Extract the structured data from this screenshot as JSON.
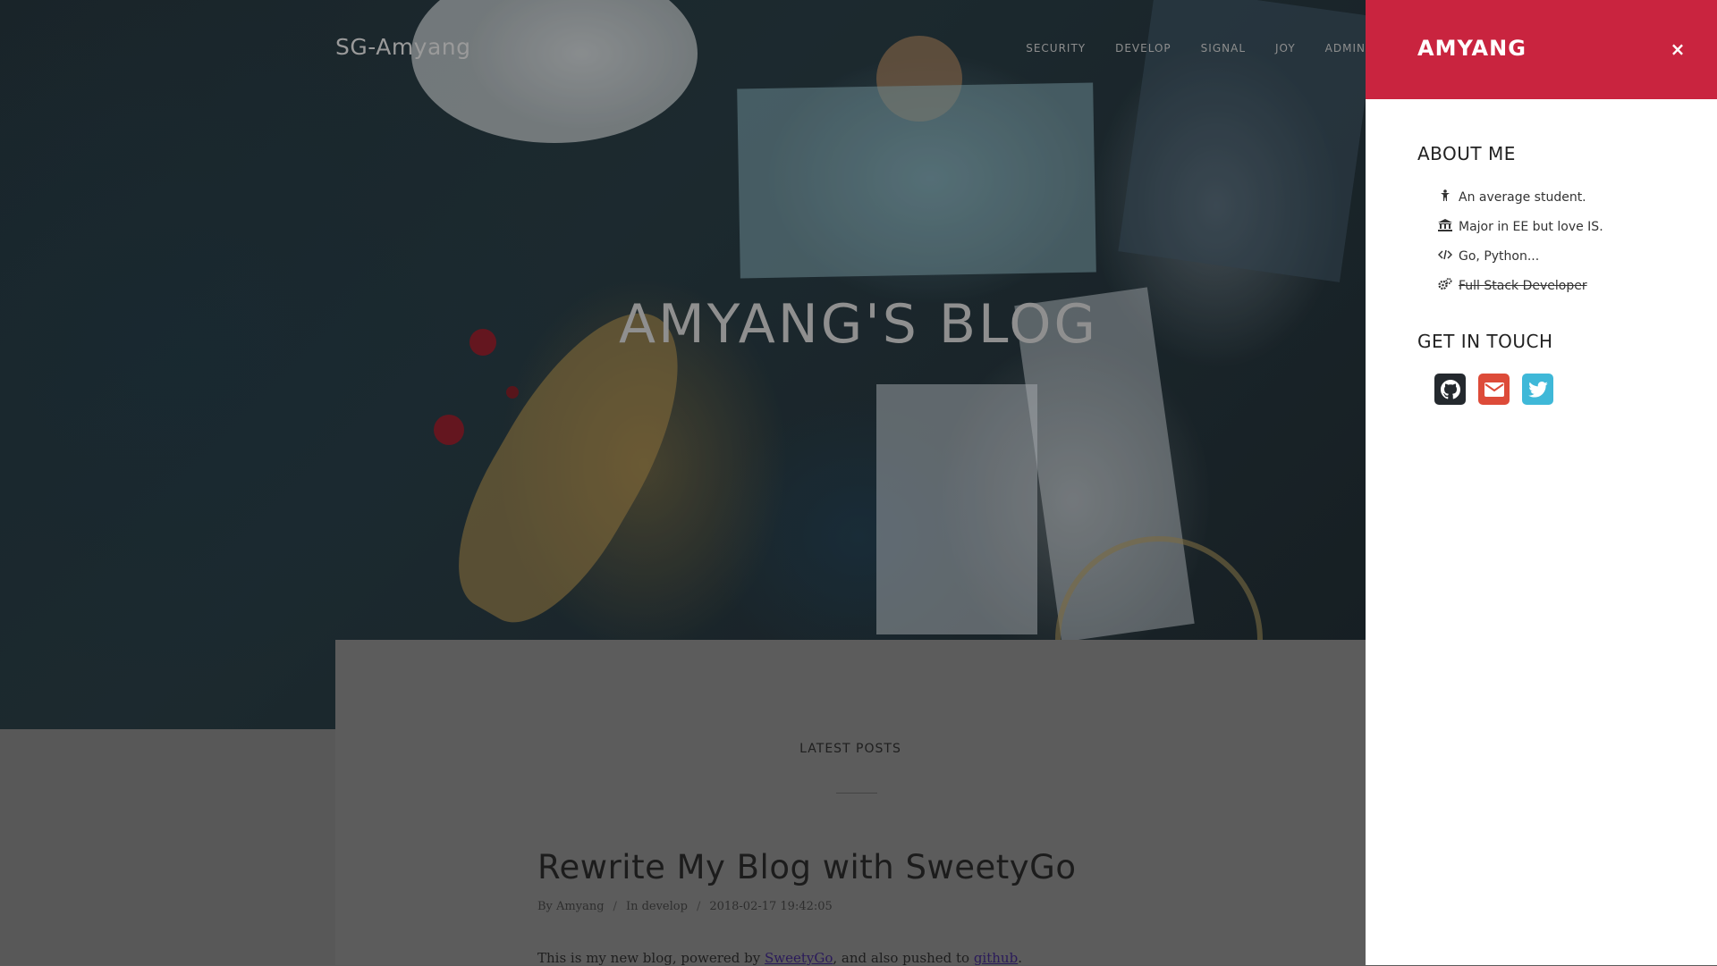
{
  "brand": "SG-Amyang",
  "nav": [
    "SECURITY",
    "DEVELOP",
    "SIGNAL",
    "JOY",
    "ADMIN"
  ],
  "hero": {
    "title": "AMYANG'S BLOG"
  },
  "content": {
    "section_label": "LATEST POSTS",
    "post": {
      "title": "Rewrite My Blog with SweetyGo",
      "author": "By Amyang",
      "category": "In develop",
      "date": "2018-02-17 19:42:05",
      "separator": "/",
      "body_prefix": "This is my new blog, powered by ",
      "body_link1": "SweetyGo",
      "body_middle": ", and also pushed to ",
      "body_link2": "github",
      "body_suffix": "."
    }
  },
  "panel": {
    "title": "AMYANG",
    "close": "×",
    "about_title": "ABOUT ME",
    "about_items": [
      {
        "icon": "person-icon",
        "text": "An average student."
      },
      {
        "icon": "university-icon",
        "text": "Major in EE but love IS."
      },
      {
        "icon": "code-icon",
        "text": "Go, Python..."
      },
      {
        "icon": "gears-icon",
        "text": "Full Stack Developer",
        "strikethrough": true
      }
    ],
    "touch_title": "GET IN TOUCH",
    "social": [
      {
        "icon": "github-icon",
        "color": "#24292e"
      },
      {
        "icon": "envelope-icon",
        "color": "#dd4b39"
      },
      {
        "icon": "twitter-icon",
        "color": "#3fb8d8"
      }
    ]
  },
  "colors": {
    "accent": "#c9243f",
    "overlay": "#5c5c5c"
  }
}
